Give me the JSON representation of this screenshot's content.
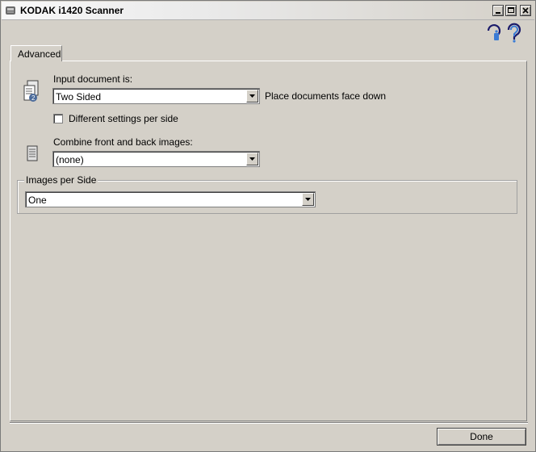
{
  "window": {
    "title": "KODAK i1420 Scanner"
  },
  "title_controls": {
    "minimize": "minimize-icon",
    "maximize": "maximize-icon",
    "close": "close-icon"
  },
  "header_icons": [
    "info-help-icon",
    "help-icon"
  ],
  "tabs": [
    {
      "label": "Advanced",
      "active": true
    }
  ],
  "advanced": {
    "input_document_label": "Input document is:",
    "input_document_value": "Two Sided",
    "input_document_hint": "Place documents face down",
    "different_settings_label": "Different settings per side",
    "different_settings_checked": false,
    "combine_label": "Combine front and back images:",
    "combine_value": "(none)",
    "images_per_side_legend": "Images per Side",
    "images_per_side_value": "One"
  },
  "footer": {
    "done_label": "Done"
  }
}
